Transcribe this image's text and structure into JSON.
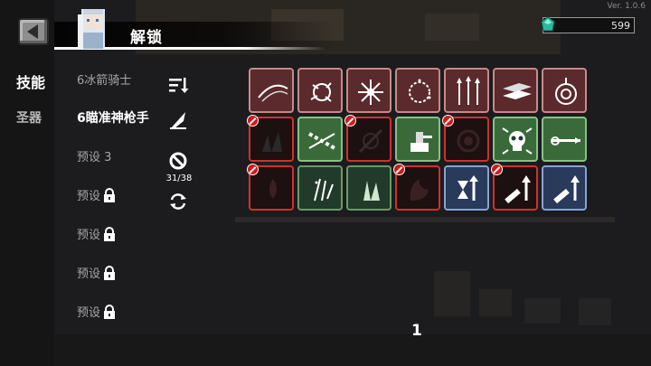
{
  "version": "Ver. 1.0.6",
  "header": {
    "title": "解锁"
  },
  "currency": {
    "value": "599",
    "icon": "gem-icon"
  },
  "categories": [
    {
      "label": "技能",
      "active": true
    },
    {
      "label": "圣器",
      "active": false
    }
  ],
  "presets": [
    {
      "label": "6冰箭骑士",
      "locked": false,
      "active": false
    },
    {
      "label": "6瞄准神枪手",
      "locked": false,
      "active": true
    },
    {
      "label": "预设 3",
      "locked": false,
      "active": false
    },
    {
      "label": "预设",
      "locked": true,
      "active": false
    },
    {
      "label": "预设",
      "locked": true,
      "active": false
    },
    {
      "label": "预设",
      "locked": true,
      "active": false
    },
    {
      "label": "预设",
      "locked": true,
      "active": false
    }
  ],
  "tools": {
    "disable_count": "31/38"
  },
  "skill_grid": [
    [
      {
        "style": "brown",
        "disabled": false,
        "icon": "slash-arc-icon"
      },
      {
        "style": "brown",
        "disabled": false,
        "icon": "burst-swirl-icon"
      },
      {
        "style": "brown",
        "disabled": false,
        "icon": "spark-burst-icon"
      },
      {
        "style": "brown",
        "disabled": false,
        "icon": "ring-sparks-icon"
      },
      {
        "style": "brown",
        "disabled": false,
        "icon": "triple-arrows-icon"
      },
      {
        "style": "brown",
        "disabled": false,
        "icon": "cards-spread-icon"
      },
      {
        "style": "brown",
        "disabled": false,
        "icon": "target-icon"
      }
    ],
    [
      {
        "style": "red",
        "disabled": true,
        "icon": "shards-icon"
      },
      {
        "style": "green",
        "disabled": false,
        "icon": "star-chain-icon"
      },
      {
        "style": "red",
        "disabled": true,
        "icon": "swirl-slash-icon"
      },
      {
        "style": "green",
        "disabled": false,
        "icon": "turret-icon"
      },
      {
        "style": "red",
        "disabled": true,
        "icon": "vortex-icon"
      },
      {
        "style": "green",
        "disabled": false,
        "icon": "skull-burst-icon"
      },
      {
        "style": "green",
        "disabled": false,
        "icon": "lance-icon"
      }
    ],
    [
      {
        "style": "red",
        "disabled": true,
        "icon": "fire-drop-icon"
      },
      {
        "style": "dgreen",
        "disabled": false,
        "icon": "sparkle-blades-icon"
      },
      {
        "style": "dgreen",
        "disabled": false,
        "icon": "crystal-icon"
      },
      {
        "style": "red",
        "disabled": true,
        "icon": "flame-spirit-icon"
      },
      {
        "style": "blue",
        "disabled": false,
        "icon": "hourglass-up-icon"
      },
      {
        "style": "red",
        "disabled": true,
        "icon": "gun-up-icon"
      },
      {
        "style": "blue",
        "disabled": false,
        "icon": "gun-up-icon"
      }
    ]
  ],
  "pagination": {
    "page": "1"
  }
}
